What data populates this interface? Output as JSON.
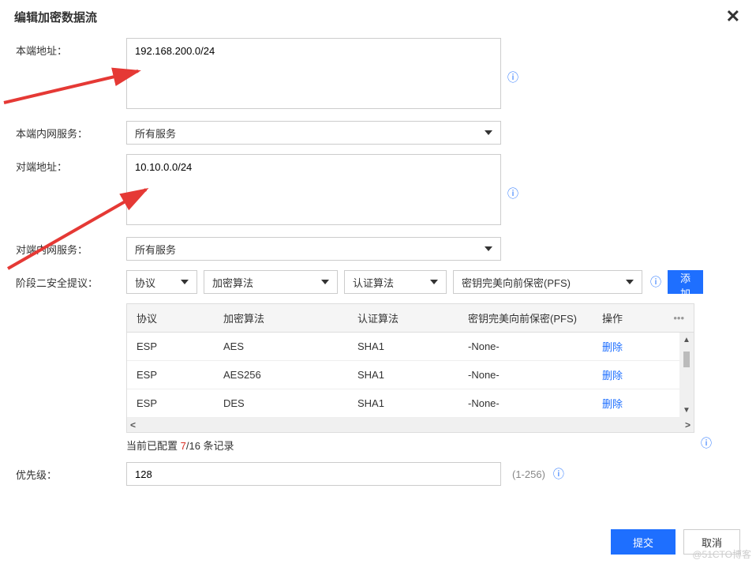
{
  "dialog_title": "编辑加密数据流",
  "labels": {
    "local_addr": "本端地址：",
    "local_service": "本端内网服务：",
    "peer_addr": "对端地址：",
    "peer_service": "对端内网服务：",
    "phase2": "阶段二安全提议：",
    "priority": "优先级："
  },
  "values": {
    "local_addr": "192.168.200.0/24",
    "peer_addr": "10.10.0.0/24",
    "priority": "128"
  },
  "selects": {
    "local_service": "所有服务",
    "peer_service": "所有服务",
    "protocol": "协议",
    "encrypt": "加密算法",
    "auth": "认证算法",
    "pfs": "密钥完美向前保密(PFS)"
  },
  "buttons": {
    "add": "添加",
    "submit": "提交",
    "cancel": "取消"
  },
  "table": {
    "headers": {
      "protocol": "协议",
      "encrypt": "加密算法",
      "auth": "认证算法",
      "pfs": "密钥完美向前保密(PFS)",
      "op": "操作"
    },
    "rows": [
      {
        "protocol": "ESP",
        "encrypt": "AES",
        "auth": "SHA1",
        "pfs": "-None-",
        "op": "删除"
      },
      {
        "protocol": "ESP",
        "encrypt": "AES256",
        "auth": "SHA1",
        "pfs": "-None-",
        "op": "删除"
      },
      {
        "protocol": "ESP",
        "encrypt": "DES",
        "auth": "SHA1",
        "pfs": "-None-",
        "op": "删除"
      }
    ]
  },
  "summary": {
    "prefix": "当前已配置 ",
    "count": "7",
    "suffix": "/16 条记录"
  },
  "priority_range": "(1-256)",
  "watermark": "@51CTO博客",
  "info_glyph": "ⓘ",
  "more_glyph": "•••"
}
